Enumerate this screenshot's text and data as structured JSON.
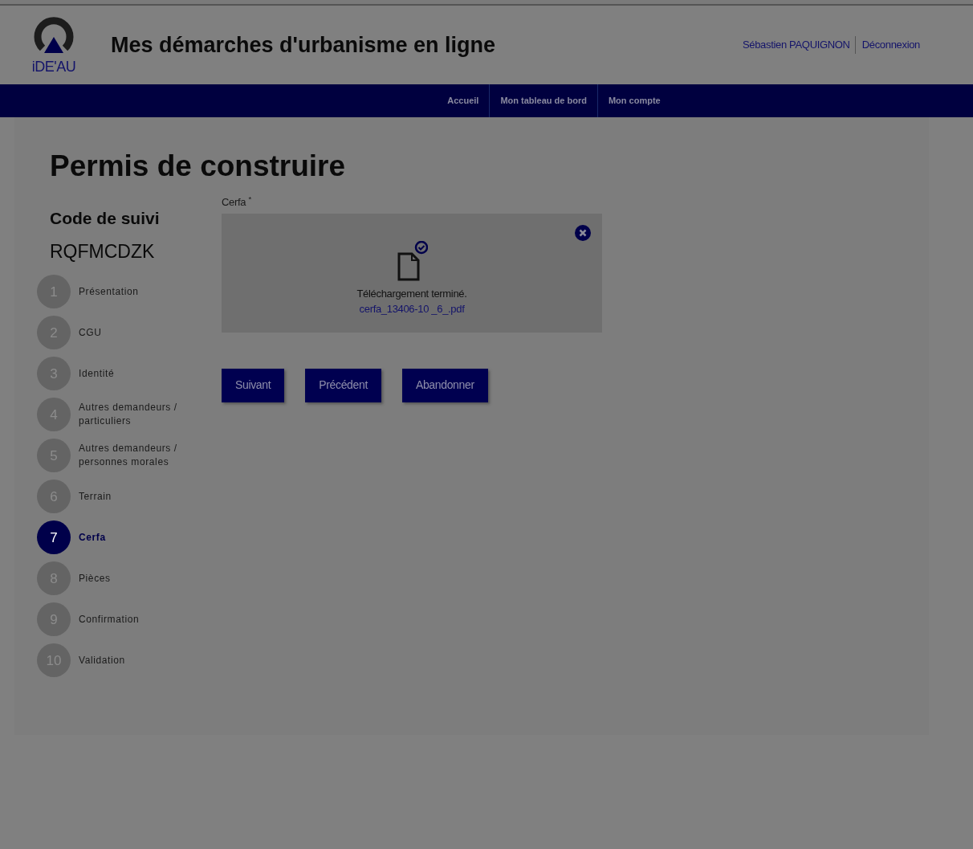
{
  "header": {
    "logo_text": "iDE'AU",
    "title": "Mes démarches d'urbanisme en ligne",
    "user": "Sébastien PAQUIGNON",
    "logout": "Déconnexion"
  },
  "nav": [
    {
      "label": "Accueil"
    },
    {
      "label": "Mon tableau de bord"
    },
    {
      "label": "Mon compte"
    }
  ],
  "page_title": "Permis de construire",
  "tracking": {
    "label": "Code de suivi",
    "code": "RQFMCDZK"
  },
  "steps": [
    {
      "number": "1",
      "label": "Présentation",
      "selected": false
    },
    {
      "number": "2",
      "label": "CGU",
      "selected": false
    },
    {
      "number": "3",
      "label": "Identité",
      "selected": false
    },
    {
      "number": "4",
      "label": "Autres demandeurs / particuliers",
      "selected": false
    },
    {
      "number": "5",
      "label": "Autres demandeurs / personnes morales",
      "selected": false
    },
    {
      "number": "6",
      "label": "Terrain",
      "selected": false
    },
    {
      "number": "7",
      "label": "Cerfa",
      "selected": true
    },
    {
      "number": "8",
      "label": "Pièces",
      "selected": false
    },
    {
      "number": "9",
      "label": "Confirmation",
      "selected": false
    },
    {
      "number": "10",
      "label": "Validation",
      "selected": false
    }
  ],
  "upload": {
    "label": "Cerfa",
    "required_mark": "*",
    "status": "Téléchargement terminé.",
    "file": "cerfa_13406-10 _6_.pdf"
  },
  "buttons": [
    "Suivant",
    "Précédent",
    "Abandonner"
  ]
}
